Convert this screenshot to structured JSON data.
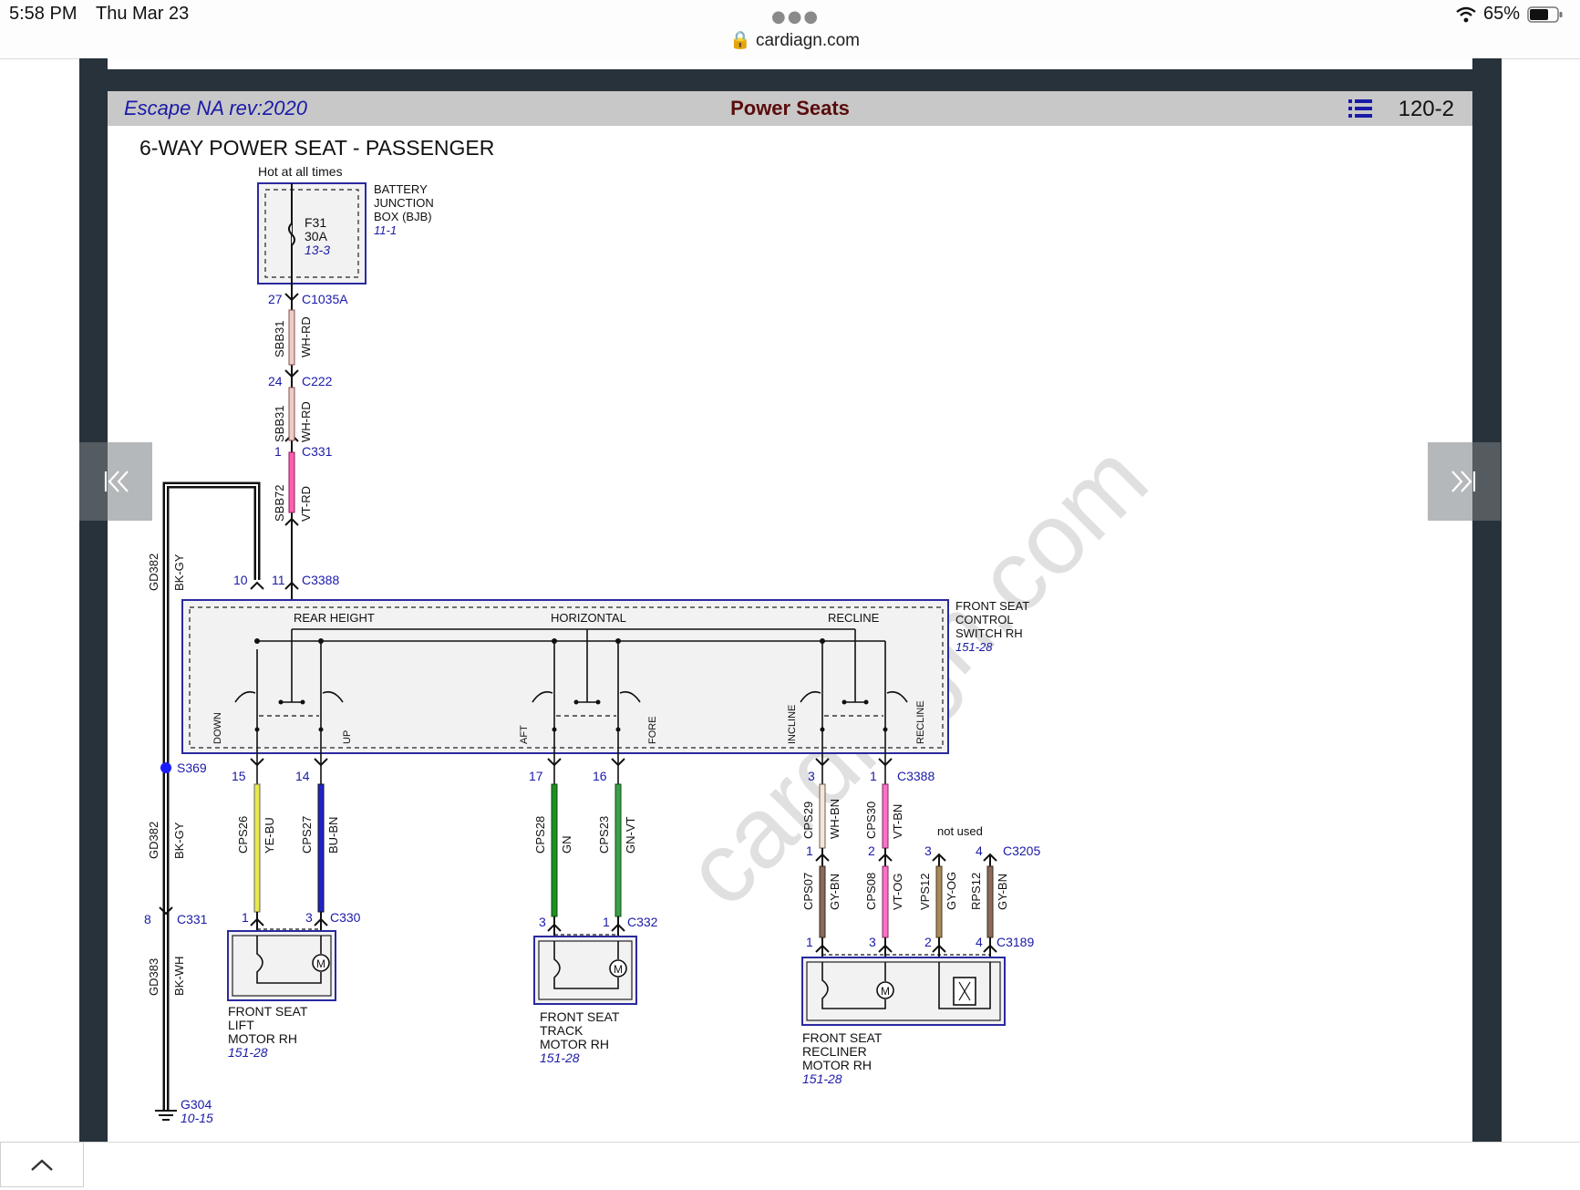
{
  "status_bar": {
    "time": "5:58 PM",
    "date": "Thu Mar 23",
    "url": "cardiagn.com",
    "battery": "65%"
  },
  "header": {
    "doc_title": "Escape NA rev:2020",
    "section_title": "Power Seats",
    "page_number": "120-2"
  },
  "diagram": {
    "title": "6-WAY POWER SEAT - PASSENGER",
    "hot_label": "Hot at all times",
    "fuse": {
      "name": "F31",
      "rating": "30A",
      "ref": "13-3"
    },
    "bjb": {
      "line1": "BATTERY",
      "line2": "JUNCTION",
      "line3": "BOX (BJB)",
      "ref": "11-1"
    },
    "connectors": {
      "c1035a": {
        "pin": "27",
        "name": "C1035A"
      },
      "c222": {
        "pin": "24",
        "name": "C222"
      },
      "c331_top": {
        "pin": "1",
        "name": "C331"
      },
      "c3388_top": {
        "pin10": "10",
        "pin11": "11",
        "name": "C3388"
      },
      "c3388_bottom": {
        "name": "C3388"
      },
      "c330": {
        "name": "C330"
      },
      "c332": {
        "name": "C332"
      },
      "c3205": {
        "name": "C3205"
      },
      "c3189": {
        "name": "C3189"
      },
      "c331_bottom": {
        "pin": "8",
        "name": "C331"
      }
    },
    "wires": {
      "sbb31_a": {
        "circuit": "SBB31",
        "color": "WH-RD"
      },
      "sbb31_b": {
        "circuit": "SBB31",
        "color": "WH-RD"
      },
      "sbb72": {
        "circuit": "SBB72",
        "color": "VT-RD"
      },
      "gd382_top": {
        "circuit": "GD382",
        "color": "BK-GY"
      },
      "gd382_mid": {
        "circuit": "GD382",
        "color": "BK-GY"
      },
      "gd383": {
        "circuit": "GD383",
        "color": "BK-WH"
      },
      "cps26": {
        "circuit": "CPS26",
        "color": "YE-BU",
        "pin_top": "15",
        "pin_bot": "1"
      },
      "cps27": {
        "circuit": "CPS27",
        "color": "BU-BN",
        "pin_top": "14",
        "pin_bot": "3"
      },
      "cps28": {
        "circuit": "CPS28",
        "color": "GN",
        "pin_top": "17",
        "pin_bot": "3"
      },
      "cps23": {
        "circuit": "CPS23",
        "color": "GN-VT",
        "pin_top": "16",
        "pin_bot": "1"
      },
      "cps29": {
        "circuit": "CPS29",
        "color": "WH-BN",
        "pin_top": "3",
        "pin_bot": "1"
      },
      "cps30": {
        "circuit": "CPS30",
        "color": "VT-BN",
        "pin_top": "1",
        "pin_bot": "2"
      },
      "cps07": {
        "circuit": "CPS07",
        "color": "GY-BN",
        "pin_top": "1",
        "pin_bot": "1"
      },
      "cps08": {
        "circuit": "CPS08",
        "color": "VT-OG",
        "pin_top": "2",
        "pin_bot": "3"
      },
      "vps12": {
        "circuit": "VPS12",
        "color": "GY-OG",
        "pin_top": "3",
        "pin_bot": "2"
      },
      "rps12": {
        "circuit": "RPS12",
        "color": "GY-BN",
        "pin_top": "4",
        "pin_bot": "4"
      }
    },
    "splice": {
      "name": "S369"
    },
    "ground": {
      "name": "G304",
      "ref": "10-15"
    },
    "not_used": "not used",
    "switch": {
      "line1": "FRONT SEAT",
      "line2": "CONTROL",
      "line3": "SWITCH RH",
      "ref": "151-28",
      "groups": [
        "REAR HEIGHT",
        "HORIZONTAL",
        "RECLINE"
      ],
      "positions": [
        "DOWN",
        "UP",
        "AFT",
        "FORE",
        "INCLINE",
        "RECLINE"
      ]
    },
    "lift_motor": {
      "line1": "FRONT SEAT",
      "line2": "LIFT",
      "line3": "MOTOR RH",
      "ref": "151-28"
    },
    "track_motor": {
      "line1": "FRONT SEAT",
      "line2": "TRACK",
      "line3": "MOTOR RH",
      "ref": "151-28"
    },
    "recliner_motor": {
      "line1": "FRONT SEAT",
      "line2": "RECLINER",
      "line3": "MOTOR RH",
      "ref": "151-28"
    },
    "motor_symbol": "M",
    "watermark": "cardiagn.com"
  },
  "colors": {
    "blue_label": "#1a1aa8",
    "box_border": "#2a2aa0",
    "header_bg": "#c8c8c8",
    "section_title": "#5a0c0c"
  }
}
